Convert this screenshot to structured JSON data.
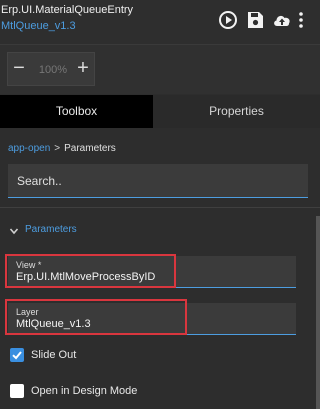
{
  "header": {
    "app_title": "Erp.UI.MaterialQueueEntry",
    "layer_link": "MtlQueue_v1.3",
    "buttons": [
      {
        "icon": "play-circle-icon"
      },
      {
        "icon": "save-icon"
      },
      {
        "icon": "cloud-upload-icon"
      },
      {
        "icon": "more-vertical-icon"
      }
    ]
  },
  "zoom": {
    "minus": "−",
    "value": "100%",
    "plus": "+"
  },
  "tabs": [
    {
      "label": "Toolbox",
      "active": true
    },
    {
      "label": "Properties",
      "active": false
    }
  ],
  "breadcrumb": {
    "link": "app-open",
    "separator": ">",
    "current": "Parameters"
  },
  "search": {
    "placeholder": "Search.."
  },
  "section": {
    "label": "Parameters",
    "expanded": true
  },
  "fields": {
    "view": {
      "label": "View *",
      "value": "Erp.UI.MtlMoveProcessByID"
    },
    "layer": {
      "label": "Layer",
      "value": "MtlQueue_v1.3"
    }
  },
  "checkboxes": {
    "slide_out": {
      "label": "Slide Out",
      "checked": true
    },
    "design_mode": {
      "label": "Open in Design Mode",
      "checked": false
    }
  },
  "colors": {
    "accent": "#4d9de0",
    "highlight": "#d9363e",
    "background": "#2d2d2d"
  }
}
